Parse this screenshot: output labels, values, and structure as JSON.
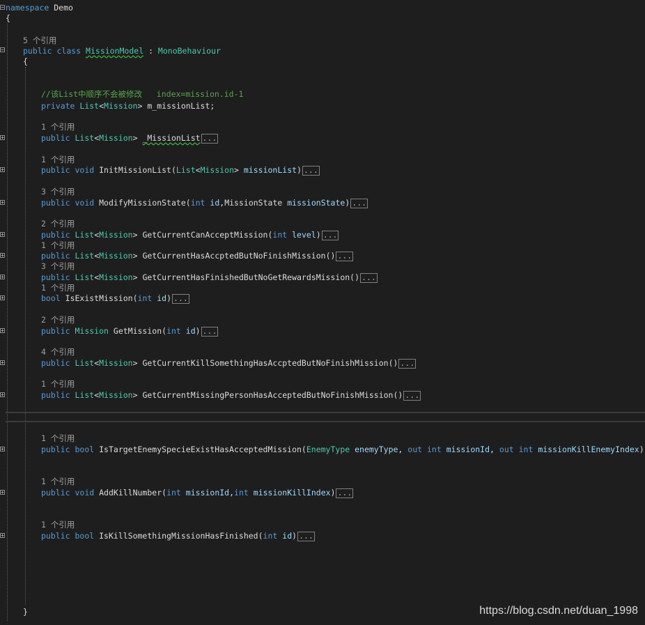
{
  "editor": {
    "namespace_kw": "namespace",
    "namespace_name": "Demo",
    "open_brace": "{",
    "close_brace": "}",
    "class_refs": "5 个引用",
    "class_kw_public": "public",
    "class_kw_class": "class",
    "class_name": "MissionModel",
    "class_colon": " : ",
    "base_class": "MonoBehaviour",
    "comment": "//该List中顺序不会被修改   index=mission.id-1",
    "field": {
      "kw": "private",
      "type": "List",
      "generic": "Mission",
      "name": "m_missionList;"
    },
    "collapsed_marker": "...",
    "members": [
      {
        "refs": "1 个引用"
      },
      {
        "refs": "1 个引用"
      },
      {
        "refs": "3 个引用"
      },
      {
        "refs": "2 个引用"
      },
      {
        "refs": "1 个引用"
      },
      {
        "refs": "3 个引用"
      },
      {
        "refs": "1 个引用"
      },
      {
        "refs": "2 个引用"
      },
      {
        "refs": "4 个引用"
      },
      {
        "refs": "1 个引用"
      },
      {
        "refs": "1 个引用"
      },
      {
        "refs": "1 个引用"
      },
      {
        "refs": "1 个引用"
      }
    ],
    "tokens": {
      "public": "public",
      "void": "void",
      "bool": "bool",
      "int": "int",
      "out": "out",
      "List": "List",
      "Mission": "Mission",
      "MissionState": "MissionState",
      "EnemyType": "EnemyType",
      "m0_name": "_MissionList",
      "m1_name": "InitMissionList",
      "m1_param": "missionList",
      "m2_name": "ModifyMissionState",
      "id": "id",
      "m2_param2": "missionState",
      "m3_name": "GetCurrentCanAcceptMission",
      "level": "level",
      "m4_name": "GetCurrentHasAccptedButNoFinishMission",
      "m5_name": "GetCurrentHasFinishedButNoGetRewardsMission",
      "m6_name": "IsExistMission",
      "m7_name": "GetMission",
      "m8_name": "GetCurrentKillSomethingHasAccptedButNoFinishMission",
      "m9_name": "GetCurrentMissingPersonHasAcceptedButNoFinishMission",
      "m10_name": "IsTargetEnemySpecieExistHasAcceptedMission",
      "enemyType": "enemyType",
      "missionId": "missionId",
      "missionKillEnemyIndex": "missionKillEnemyIndex",
      "m11_name": "AddKillNumber",
      "missionKillIndex": "missionKillIndex",
      "m12_name": "IsKillSomethingMissionHasFinished"
    }
  },
  "watermark": "https://blog.csdn.net/duan_1998",
  "colors": {
    "background": "#1e1e1e",
    "keyword": "#569cd6",
    "type": "#4ec9b0",
    "parameter": "#9cdcfe",
    "comment": "#57a64a",
    "reference_lens": "#a0a0a0"
  }
}
